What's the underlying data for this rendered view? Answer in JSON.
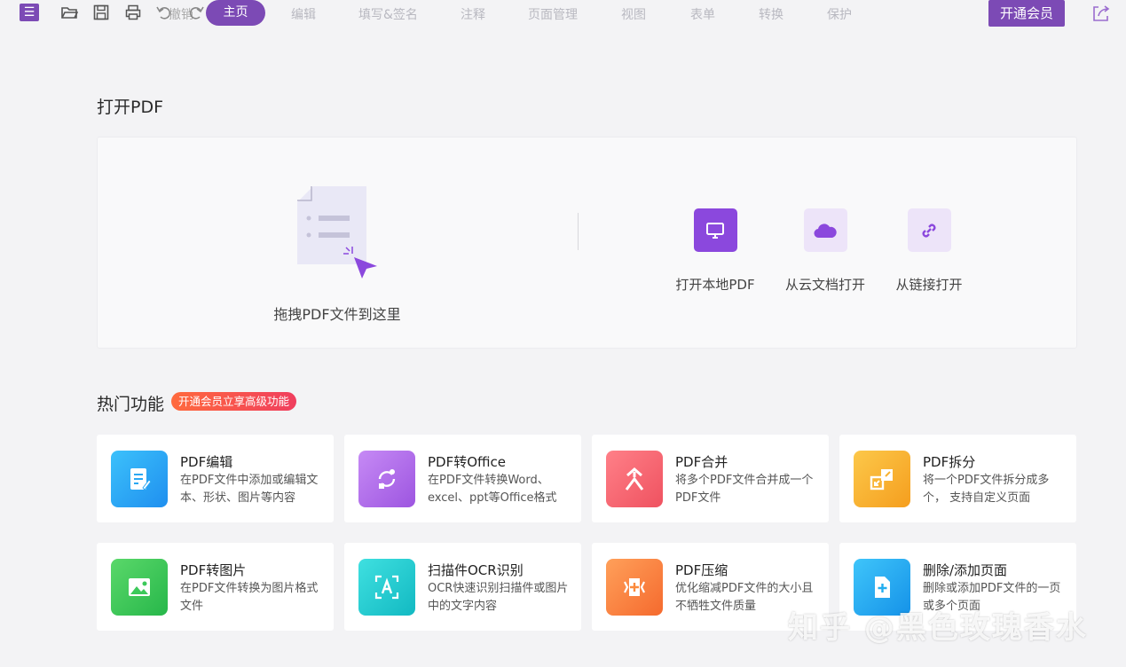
{
  "toolbar": {
    "menu_icon": "hamburger-icon",
    "tabs": [
      "主页",
      "编辑",
      "填写&签名",
      "注释",
      "页面管理",
      "视图",
      "表单",
      "转换",
      "保护"
    ],
    "undo_label": "撤销",
    "vip_button": "开通会员",
    "accent_color": "#7c4ab5"
  },
  "open_section": {
    "title": "打开PDF",
    "drop_text": "拖拽PDF文件到这里",
    "options": [
      {
        "label": "打开本地PDF",
        "icon": "monitor-icon"
      },
      {
        "label": "从云文档打开",
        "icon": "cloud-icon"
      },
      {
        "label": "从链接打开",
        "icon": "link-icon"
      }
    ]
  },
  "features_section": {
    "title": "热门功能",
    "badge": "开通会员立享高级功能",
    "items": [
      {
        "title": "PDF编辑",
        "desc": "在PDF文件中添加或编辑文本、形状、图片等内容",
        "icon": "edit-doc-icon",
        "color": "#2aa7f2"
      },
      {
        "title": "PDF转Office",
        "desc": "在PDF文件转换Word、excel、ppt等Office格式",
        "icon": "convert-icon",
        "color": "#b26fe8"
      },
      {
        "title": "PDF合并",
        "desc": "将多个PDF文件合并成一个PDF文件",
        "icon": "merge-icon",
        "color": "#f4636e"
      },
      {
        "title": "PDF拆分",
        "desc": "将一个PDF文件拆分成多个， 支持自定义页面",
        "icon": "split-icon",
        "color": "#f8b233"
      },
      {
        "title": "PDF转图片",
        "desc": "在PDF文件转换为图片格式文件",
        "icon": "image-icon",
        "color": "#3cc95a"
      },
      {
        "title": "扫描件OCR识别",
        "desc": "OCR快速识别扫描件或图片中的文字内容",
        "icon": "ocr-icon",
        "color": "#1ecdd0"
      },
      {
        "title": "PDF压缩",
        "desc": "优化缩减PDF文件的大小且不牺牲文件质量",
        "icon": "compress-icon",
        "color": "#fb8a3c"
      },
      {
        "title": "删除/添加页面",
        "desc": "删除或添加PDF文件的一页或多个页面",
        "icon": "add-page-icon",
        "color": "#22aef0"
      }
    ]
  },
  "watermark": "知乎 @黑色玫瑰香水"
}
